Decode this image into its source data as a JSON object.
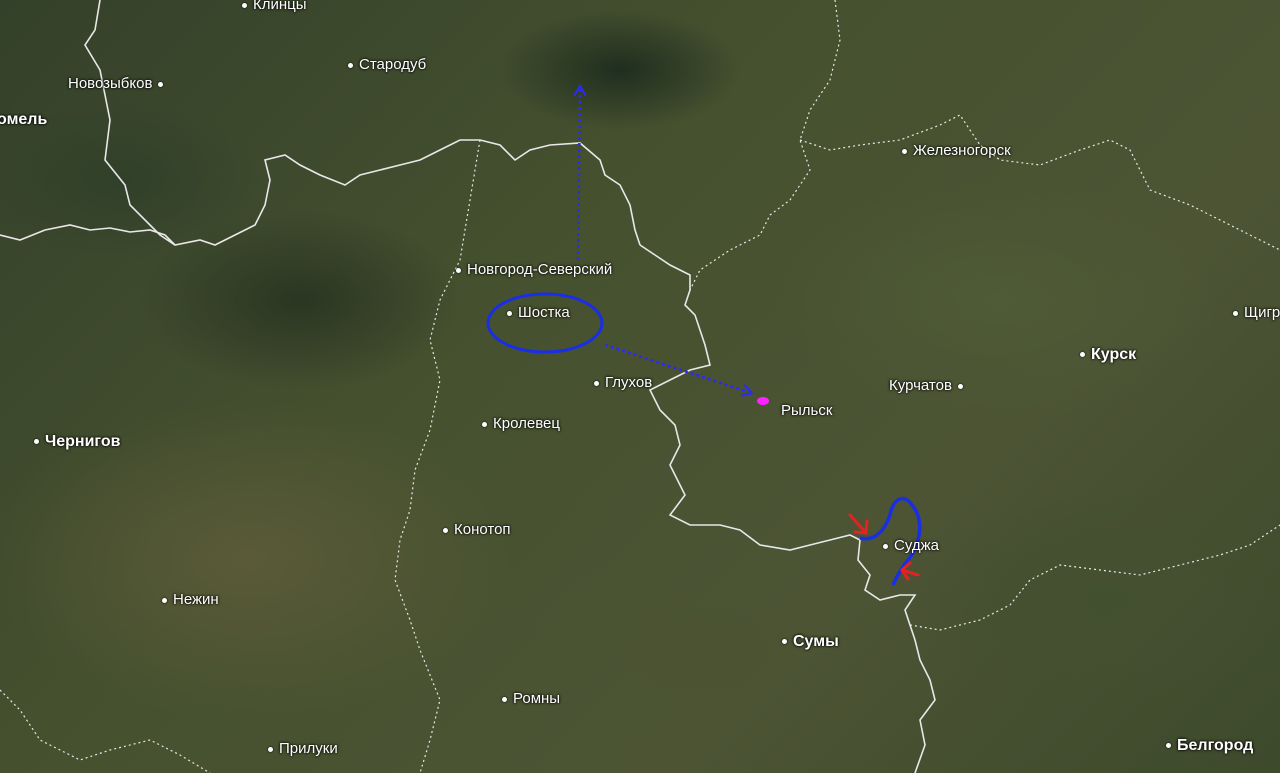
{
  "map": {
    "type": "satellite",
    "annotations": {
      "dotted_arrow_color": "#2a2aff",
      "ellipse_color": "#1a2ee6",
      "front_line_color": "#1a2ee6",
      "attack_arrow_color": "#e52222",
      "marker_color": "#ff22ff",
      "border_color": "#ffffff"
    }
  },
  "cities": {
    "klintsy": "Клинцы",
    "novozybkov": "Новозыбков",
    "starodub": "Стародуб",
    "gomel": "омель",
    "zheleznogorsk": "Железногорск",
    "novgorod_seversky": "Новгород-Северский",
    "shostka": "Шостка",
    "glukhov": "Глухов",
    "rylsk": "Рыльск",
    "kurchatov": "Курчатов",
    "kursk": "Курск",
    "shchigry": "Щигр",
    "chernigov": "Чернигов",
    "krolevets": "Кролевец",
    "konotop": "Конотоп",
    "sudzha": "Суджа",
    "nezhin": "Нежин",
    "sumy": "Сумы",
    "romny": "Ромны",
    "priluki": "Прилуки",
    "belgorod": "Белгород"
  }
}
